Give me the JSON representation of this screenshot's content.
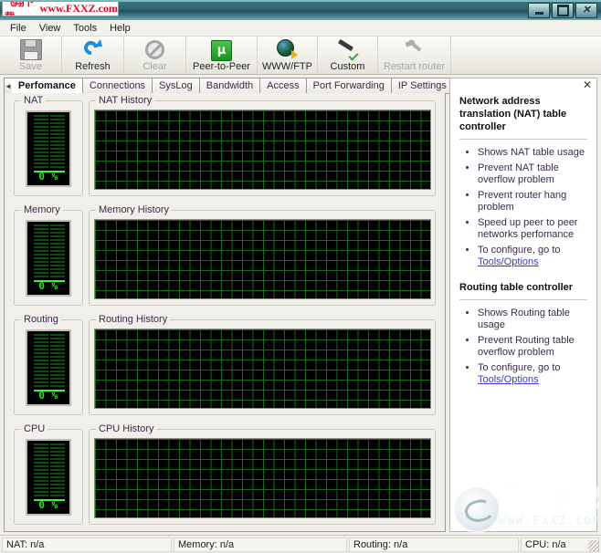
{
  "window": {
    "watermark_cn": "飞翔下载",
    "watermark_url": "www.FXXZ.com",
    "minimize_label": "Minimize",
    "maximize_label": "Maximize",
    "close_label": "Close"
  },
  "menubar": {
    "items": [
      {
        "label": "File"
      },
      {
        "label": "View"
      },
      {
        "label": "Tools"
      },
      {
        "label": "Help"
      }
    ]
  },
  "toolbar": {
    "buttons": [
      {
        "label": "Save",
        "icon": "floppy-disk-icon",
        "enabled": false
      },
      {
        "label": "Refresh",
        "icon": "refresh-icon",
        "enabled": true
      },
      {
        "label": "Clear",
        "icon": "no-entry-icon",
        "enabled": false
      },
      {
        "label": "Peer-to-Peer",
        "icon": "utorrent-icon",
        "enabled": true
      },
      {
        "label": "WWW/FTP",
        "icon": "globe-icon",
        "enabled": true
      },
      {
        "label": "Custom",
        "icon": "screwdriver-icon",
        "enabled": true
      },
      {
        "label": "Restart router",
        "icon": "hammer-icon",
        "enabled": false
      }
    ]
  },
  "tabs": {
    "scroll_left": "◄",
    "scroll_right": "►",
    "items": [
      {
        "label": "Perfomance",
        "active": true
      },
      {
        "label": "Connections",
        "active": false
      },
      {
        "label": "SysLog",
        "active": false
      },
      {
        "label": "Bandwidth",
        "active": false
      },
      {
        "label": "Access",
        "active": false
      },
      {
        "label": "Port Forwarding",
        "active": false
      },
      {
        "label": "IP Settings",
        "active": false
      }
    ]
  },
  "performance": {
    "sections": [
      {
        "gauge_title": "NAT",
        "history_title": "NAT History",
        "value": "0 %"
      },
      {
        "gauge_title": "Memory",
        "history_title": "Memory History",
        "value": "0 %"
      },
      {
        "gauge_title": "Routing",
        "history_title": "Routing History",
        "value": "0 %"
      },
      {
        "gauge_title": "CPU",
        "history_title": "CPU History",
        "value": "0 %"
      }
    ]
  },
  "info_panel": {
    "close_glyph": "✕",
    "nat": {
      "heading": "Network address translation (NAT) table controller",
      "bullets": [
        {
          "text": "Shows NAT table usage",
          "link": ""
        },
        {
          "text": "Prevent NAT table overflow problem",
          "link": ""
        },
        {
          "text": "Prevent router hang problem",
          "link": ""
        },
        {
          "text": "Speed up peer to peer networks perfomance",
          "link": ""
        },
        {
          "text": "To configure, go to ",
          "link": "Tools/Options"
        }
      ]
    },
    "routing": {
      "heading": "Routing table controller",
      "bullets": [
        {
          "text": "Shows Routing table usage",
          "link": ""
        },
        {
          "text": "Prevent Routing table overflow problem",
          "link": ""
        },
        {
          "text": "To configure, go to ",
          "link": "Tools/Options"
        }
      ]
    }
  },
  "statusbar": {
    "cells": [
      {
        "label": "NAT: n/a"
      },
      {
        "label": "Memory: n/a"
      },
      {
        "label": "Routing: n/a"
      },
      {
        "label": "CPU: n/a"
      }
    ]
  },
  "logo_watermark": {
    "cn": "飞翔下载",
    "url": "WWW.FXXZ.COM"
  },
  "colors": {
    "titlebar": "#2d6470",
    "grid_green": "#146c14",
    "gauge_green": "#27e527",
    "link_blue": "#3a3ad0",
    "tab_text": "#3a2a4d"
  }
}
